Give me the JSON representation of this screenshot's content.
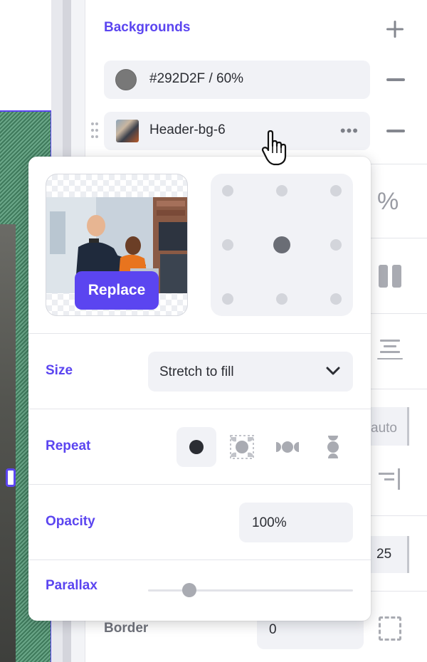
{
  "canvas": {
    "handle_icon": "resize-handle"
  },
  "sidebar": {
    "section_title": "Backgrounds",
    "add_icon": "plus-icon",
    "layers": [
      {
        "label": "#292D2F / 60%",
        "swatch_color": "#787878",
        "remove_icon": "minus-icon"
      },
      {
        "label": "Header-bg-6",
        "more_icon": "more-horizontal-icon",
        "remove_icon": "minus-icon"
      }
    ],
    "obscured": {
      "auto_value": "auto",
      "number_value": "25",
      "border_label": "Border",
      "border_value": "0"
    }
  },
  "popover": {
    "replace_label": "Replace",
    "position_grid": {
      "selected": "center"
    },
    "size": {
      "label": "Size",
      "value": "Stretch to fill"
    },
    "repeat": {
      "label": "Repeat",
      "options": [
        "no-repeat",
        "repeat",
        "repeat-x",
        "repeat-y"
      ],
      "selected": "no-repeat"
    },
    "opacity": {
      "label": "Opacity",
      "value": "100%"
    },
    "parallax": {
      "label": "Parallax",
      "level": 0.2
    }
  },
  "colors": {
    "accent": "#5B45F0",
    "field_bg": "#F1F2F6",
    "icon_gray": "#84878F"
  }
}
